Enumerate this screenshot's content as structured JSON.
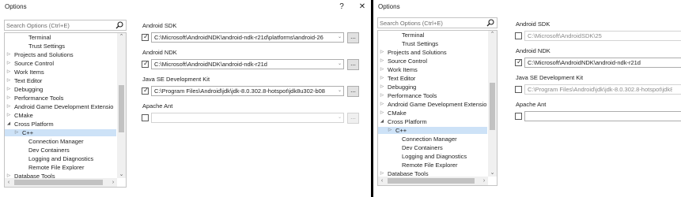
{
  "left": {
    "title": "Options",
    "help_button": "?",
    "close_button": "✕",
    "search_placeholder": "Search Options (Ctrl+E)",
    "tree": {
      "items": [
        {
          "label": "Terminal",
          "arrow": ""
        },
        {
          "label": "Trust Settings",
          "arrow": ""
        },
        {
          "label": "Projects and Solutions",
          "arrow": "▷"
        },
        {
          "label": "Source Control",
          "arrow": "▷"
        },
        {
          "label": "Work Items",
          "arrow": "▷"
        },
        {
          "label": "Text Editor",
          "arrow": "▷"
        },
        {
          "label": "Debugging",
          "arrow": "▷"
        },
        {
          "label": "Performance Tools",
          "arrow": "▷"
        },
        {
          "label": "Android Game Development Extensio",
          "arrow": "▷"
        },
        {
          "label": "CMake",
          "arrow": "▷"
        },
        {
          "label": "Cross Platform",
          "arrow": "◢"
        },
        {
          "label": "C++",
          "arrow": "▷"
        },
        {
          "label": "Connection Manager",
          "arrow": ""
        },
        {
          "label": "Dev Containers",
          "arrow": ""
        },
        {
          "label": "Logging and Diagnostics",
          "arrow": ""
        },
        {
          "label": "Remote File Explorer",
          "arrow": ""
        },
        {
          "label": "Database Tools",
          "arrow": "▷"
        }
      ]
    },
    "settings": {
      "android_sdk": {
        "label": "Android SDK",
        "checked": true,
        "value": "C:\\Microsoft\\AndroidNDK\\android-ndk-r21d\\platforms\\android-26"
      },
      "android_ndk": {
        "label": "Android NDK",
        "checked": true,
        "value": "C:\\Microsoft\\AndroidNDK\\android-ndk-r21d"
      },
      "java_se": {
        "label": "Java SE Development Kit",
        "checked": true,
        "value": "C:\\Program Files\\Android\\jdk\\jdk-8.0.302.8-hotspot\\jdk8u302-b08"
      },
      "apache_ant": {
        "label": "Apache Ant",
        "checked": false,
        "value": ""
      }
    },
    "browse_label": "..."
  },
  "right": {
    "title": "Options",
    "search_placeholder": "Search Options (Ctrl+E)",
    "tree": {
      "items": [
        {
          "label": "Terminal",
          "arrow": ""
        },
        {
          "label": "Trust Settings",
          "arrow": ""
        },
        {
          "label": "Projects and Solutions",
          "arrow": "▷"
        },
        {
          "label": "Source Control",
          "arrow": "▷"
        },
        {
          "label": "Work Items",
          "arrow": "▷"
        },
        {
          "label": "Text Editor",
          "arrow": "▷"
        },
        {
          "label": "Debugging",
          "arrow": "▷"
        },
        {
          "label": "Performance Tools",
          "arrow": "▷"
        },
        {
          "label": "Android Game Development Extensio",
          "arrow": "▷"
        },
        {
          "label": "CMake",
          "arrow": "▷"
        },
        {
          "label": "Cross Platform",
          "arrow": "◢"
        },
        {
          "label": "C++",
          "arrow": "▷"
        },
        {
          "label": "Connection Manager",
          "arrow": ""
        },
        {
          "label": "Dev Containers",
          "arrow": ""
        },
        {
          "label": "Logging and Diagnostics",
          "arrow": ""
        },
        {
          "label": "Remote File Explorer",
          "arrow": ""
        },
        {
          "label": "Database Tools",
          "arrow": "▷"
        }
      ]
    },
    "settings": {
      "android_sdk": {
        "label": "Android SDK",
        "checked": false,
        "value": "C:\\Microsoft\\AndroidSDK\\25"
      },
      "android_ndk": {
        "label": "Android NDK",
        "checked": true,
        "value": "C:\\Microsoft\\AndroidNDK\\android-ndk-r21d"
      },
      "java_se": {
        "label": "Java SE Development Kit",
        "checked": false,
        "value": "C:\\Program Files\\Android\\jdk\\jdk-8.0.302.8-hotspot\\jdk8u"
      },
      "apache_ant": {
        "label": "Apache Ant",
        "checked": false,
        "value": ""
      }
    }
  },
  "icons": {
    "search": "search-icon",
    "checkmark": "✓",
    "dropdown": "⌄",
    "scroll_up": "⌃",
    "scroll_down": "⌄",
    "scroll_left": "‹",
    "scroll_right": "›"
  },
  "colors": {
    "selection": "#cde2f7",
    "border": "#c4c4c4",
    "divider": "#000000"
  }
}
